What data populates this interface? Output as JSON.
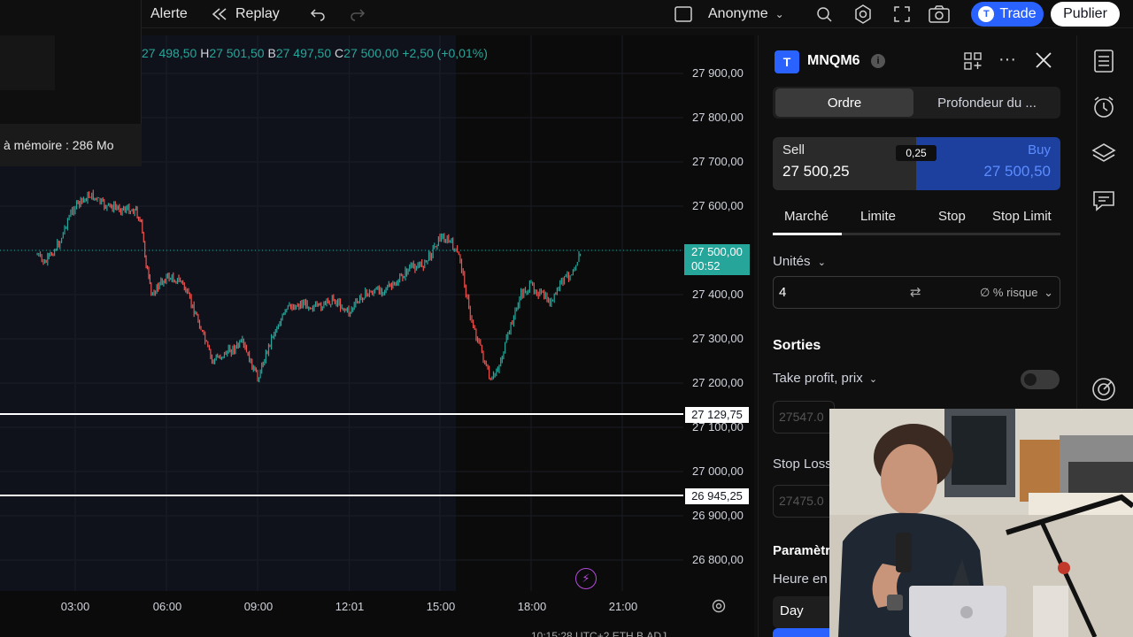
{
  "topbar": {
    "alert_label": "Alerte",
    "replay_label": "Replay",
    "account_label": "Anonyme",
    "trade_label": "Trade",
    "publish_label": "Publier"
  },
  "popup": {
    "memory_label": "à mémoire : 286 Mo"
  },
  "legend": {
    "o_value": "27 498,50",
    "h_label": "H",
    "h_value": "27 501,50",
    "b_label": "B",
    "b_value": "27 497,50",
    "c_label": "C",
    "c_value": "27 500,00",
    "change": "+2,50 (+0,01%)"
  },
  "price_scale": {
    "ticks": [
      "27 900,00",
      "27 800,00",
      "27 700,00",
      "27 600,00",
      "27 400,00",
      "27 300,00",
      "27 200,00",
      "27 100,00",
      "27 000,00",
      "26 900,00",
      "26 800,00"
    ],
    "current_price": "27 500,00",
    "countdown": "00:52",
    "line1_label": "27 129,75",
    "line2_label": "26 945,25"
  },
  "time_axis": {
    "ticks": [
      "03:00",
      "06:00",
      "09:00",
      "12:01",
      "15:00",
      "18:00",
      "21:00"
    ]
  },
  "bottom_strip": "10:15:28 UTC+2   ETH   B.ADJ",
  "colors": {
    "up": "#26a69a",
    "down": "#ef5350",
    "accent": "#2962ff",
    "session_bg": "#10121b"
  },
  "order": {
    "symbol": "MNQM6",
    "tab_active": "Ordre",
    "tab_other": "Profondeur du ...",
    "sell_label": "Sell",
    "sell_price": "27 500,25",
    "spread": "0,25",
    "buy_label": "Buy",
    "buy_price": "27 500,50",
    "order_types": [
      "Marché",
      "Limite",
      "Stop",
      "Stop Limit"
    ],
    "units_label": "Unités",
    "quantity": "4",
    "risk_label": "∅ % risque",
    "exits_label": "Sorties",
    "tp_label": "Take profit, prix",
    "tp_value": "27547.0",
    "sl_label": "Stop Loss",
    "sl_value": "27475.0",
    "params_label": "Paramètr",
    "time_label": "Heure en",
    "tif_value": "Day"
  },
  "chart_data": {
    "type": "candlestick",
    "x_ticks": [
      "03:00",
      "06:00",
      "09:00",
      "12:01",
      "15:00",
      "18:00",
      "21:00"
    ],
    "ylim": [
      26750,
      27950
    ],
    "y_ticks": [
      26800,
      26900,
      27000,
      27100,
      27200,
      27300,
      27400,
      27500,
      27600,
      27700,
      27800,
      27900
    ],
    "path_points": [
      {
        "t": "01:45",
        "p": 27490
      },
      {
        "t": "02:00",
        "p": 27470
      },
      {
        "t": "02:30",
        "p": 27520
      },
      {
        "t": "02:45",
        "p": 27570
      },
      {
        "t": "03:00",
        "p": 27600
      },
      {
        "t": "03:30",
        "p": 27625
      },
      {
        "t": "04:00",
        "p": 27600
      },
      {
        "t": "04:30",
        "p": 27595
      },
      {
        "t": "05:00",
        "p": 27590
      },
      {
        "t": "05:10",
        "p": 27560
      },
      {
        "t": "05:20",
        "p": 27470
      },
      {
        "t": "05:30",
        "p": 27400
      },
      {
        "t": "06:00",
        "p": 27440
      },
      {
        "t": "06:30",
        "p": 27430
      },
      {
        "t": "07:00",
        "p": 27350
      },
      {
        "t": "07:30",
        "p": 27250
      },
      {
        "t": "08:00",
        "p": 27270
      },
      {
        "t": "08:30",
        "p": 27290
      },
      {
        "t": "09:00",
        "p": 27210
      },
      {
        "t": "09:30",
        "p": 27310
      },
      {
        "t": "10:00",
        "p": 27370
      },
      {
        "t": "10:30",
        "p": 27380
      },
      {
        "t": "11:00",
        "p": 27370
      },
      {
        "t": "11:30",
        "p": 27390
      },
      {
        "t": "12:00",
        "p": 27360
      },
      {
        "t": "12:30",
        "p": 27400
      },
      {
        "t": "13:00",
        "p": 27410
      },
      {
        "t": "13:30",
        "p": 27420
      },
      {
        "t": "14:00",
        "p": 27460
      },
      {
        "t": "14:30",
        "p": 27470
      },
      {
        "t": "15:00",
        "p": 27530
      },
      {
        "t": "15:20",
        "p": 27520
      },
      {
        "t": "15:40",
        "p": 27480
      },
      {
        "t": "16:00",
        "p": 27350
      },
      {
        "t": "16:20",
        "p": 27280
      },
      {
        "t": "16:40",
        "p": 27200
      },
      {
        "t": "17:00",
        "p": 27250
      },
      {
        "t": "17:20",
        "p": 27330
      },
      {
        "t": "17:40",
        "p": 27400
      },
      {
        "t": "18:00",
        "p": 27420
      },
      {
        "t": "18:20",
        "p": 27400
      },
      {
        "t": "18:40",
        "p": 27380
      },
      {
        "t": "19:00",
        "p": 27430
      },
      {
        "t": "19:20",
        "p": 27450
      },
      {
        "t": "19:40",
        "p": 27500
      }
    ],
    "horizontal_lines": [
      27129.75,
      26945.25
    ],
    "last_price": 27500
  }
}
